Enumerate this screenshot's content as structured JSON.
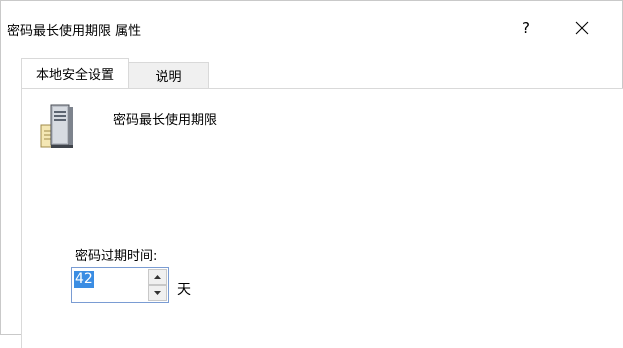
{
  "window": {
    "title": "密码最长使用期限 属性",
    "help_label": "?",
    "close_icon": "close-icon"
  },
  "tabs": [
    {
      "label": "本地安全设置",
      "active": true
    },
    {
      "label": "说明",
      "active": false
    }
  ],
  "policy": {
    "icon": "server-policy-icon",
    "name": "密码最长使用期限"
  },
  "field": {
    "label": "密码过期时间:",
    "value": "42",
    "unit": "天"
  },
  "colors": {
    "selection": "#3b8de3",
    "border": "#d9d9d9",
    "tab_inactive_bg": "#f0f0f0"
  }
}
